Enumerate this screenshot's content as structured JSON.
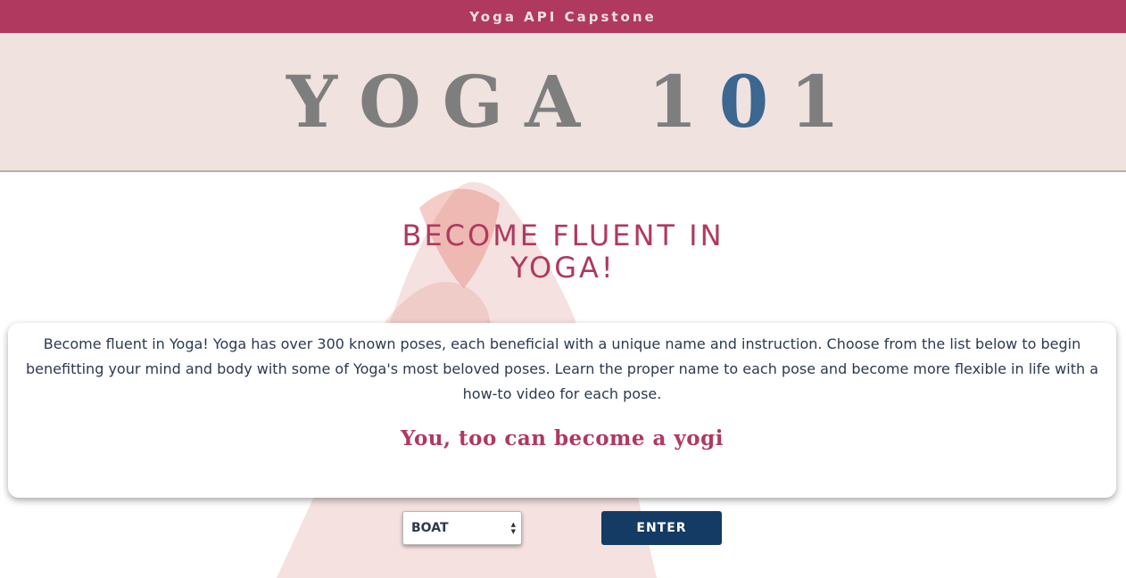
{
  "topbar": {
    "title": "Yoga API Capstone"
  },
  "hero": {
    "title_main": "YOGA 1",
    "title_accent": "0",
    "title_end": "1"
  },
  "headline": {
    "line1": "BECOME FLUENT IN",
    "line2": "YOGA!"
  },
  "card": {
    "description": "Become fluent in Yoga! Yoga has over 300 known poses, each beneficial with a unique name and instruction. Choose from the list below to begin benefitting your mind and body with some of Yoga's most beloved poses. Learn the proper name to each pose and become more flexible in life with a how-to video for each pose.",
    "tagline": "You, too can become a yogi"
  },
  "controls": {
    "selected_pose": "BOAT",
    "enter_label": "ENTER"
  },
  "colors": {
    "brand": "#b0395f",
    "hero_bg": "#efe2df",
    "button": "#133b63",
    "accent_digit": "#3b6790"
  },
  "icons": {
    "select": "chevron-updown-icon",
    "background": "yoga-pose-silhouette"
  }
}
